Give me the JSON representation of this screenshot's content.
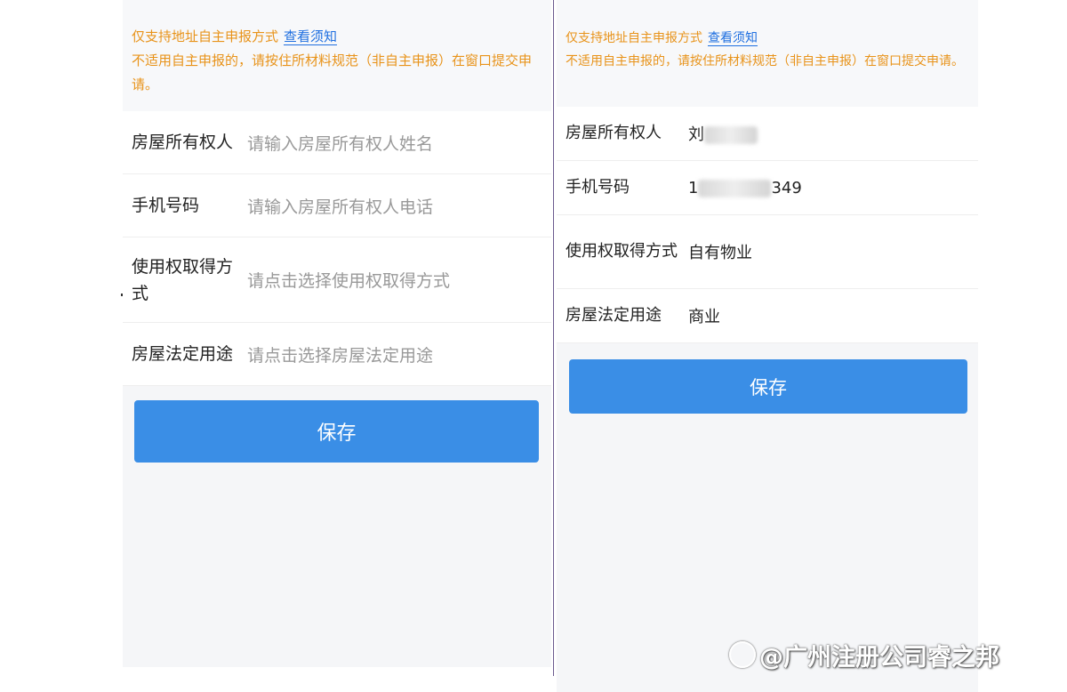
{
  "left": {
    "notice_line1": "仅支持地址自主申报方式",
    "notice_link": "查看须知",
    "notice_line2": "不适用自主申报的，请按住所材料规范（非自主申报）在窗口提交申请。",
    "fields": [
      {
        "label": "房屋所有权人",
        "value": "请输入房屋所有权人姓名"
      },
      {
        "label": "手机号码",
        "value": "请输入房屋所有权人电话"
      },
      {
        "label": "使用权取得方式",
        "value": "请点击选择使用权取得方式"
      },
      {
        "label": "房屋法定用途",
        "value": "请点击选择房屋法定用途"
      }
    ],
    "save_label": "保存"
  },
  "right": {
    "notice_line1": "仅支持地址自主申报方式",
    "notice_link": "查看须知",
    "notice_line2": "不适用自主申报的，请按住所材料规范（非自主申报）在窗口提交申请。",
    "fields": [
      {
        "label": "房屋所有权人",
        "value": "刘"
      },
      {
        "label": "手机号码",
        "value_start": "1",
        "value_end": "349"
      },
      {
        "label": "使用权取得方式",
        "value": "自有物业"
      },
      {
        "label": "房屋法定用途",
        "value": "商业"
      }
    ],
    "save_label": "保存"
  },
  "watermark": "@广州注册公司睿之邦"
}
